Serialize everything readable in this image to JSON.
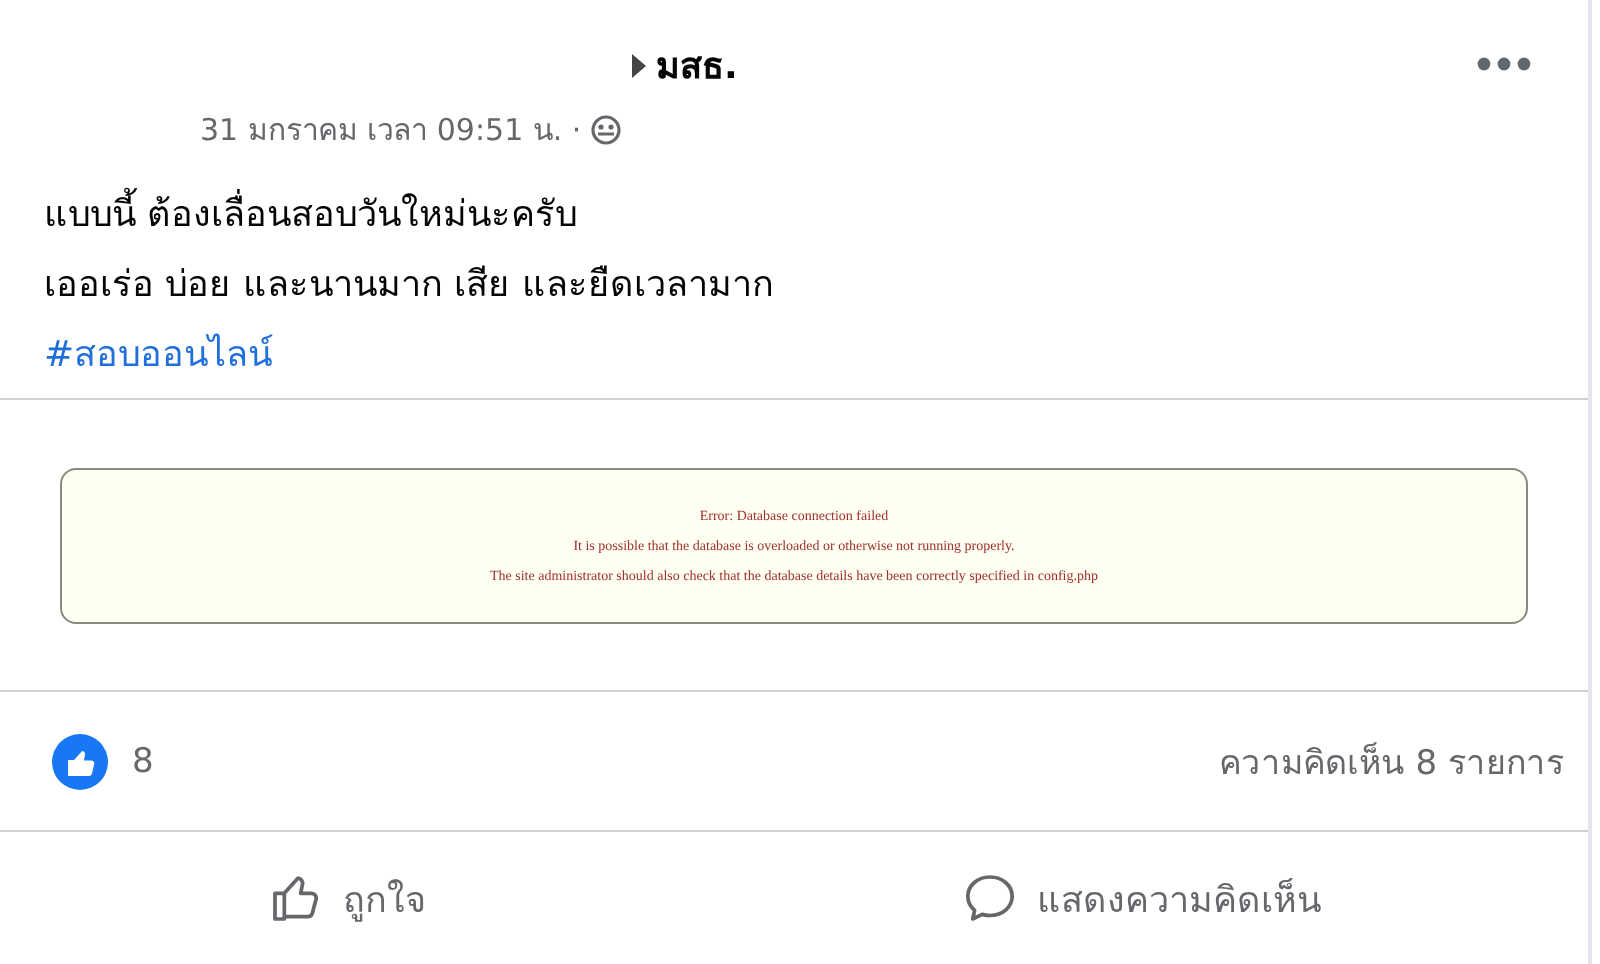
{
  "post": {
    "author": "มสธ.",
    "timestamp": "31 มกราคม เวลา 09:51 น. ·",
    "lines": [
      "แบบนี้ ต้องเลื่อนสอบวันใหม่นะครับ",
      "เออเร่อ บ่อย และนานมาก เสีย และยืดเวลามาก"
    ],
    "hashtag": "#สอบออนไลน์"
  },
  "error_panel": {
    "lines": [
      "Error: Database connection failed",
      "It is possible that the database is overloaded or otherwise not running properly.",
      "The site administrator should also check that the database details have been correctly specified in config.php"
    ]
  },
  "reactions": {
    "count": "8",
    "comments": "ความคิดเห็น 8 รายการ"
  },
  "actions": [
    {
      "kind": "like",
      "label": "ถูกใจ"
    },
    {
      "kind": "comment",
      "label": "แสดงความคิดเห็น"
    }
  ]
}
